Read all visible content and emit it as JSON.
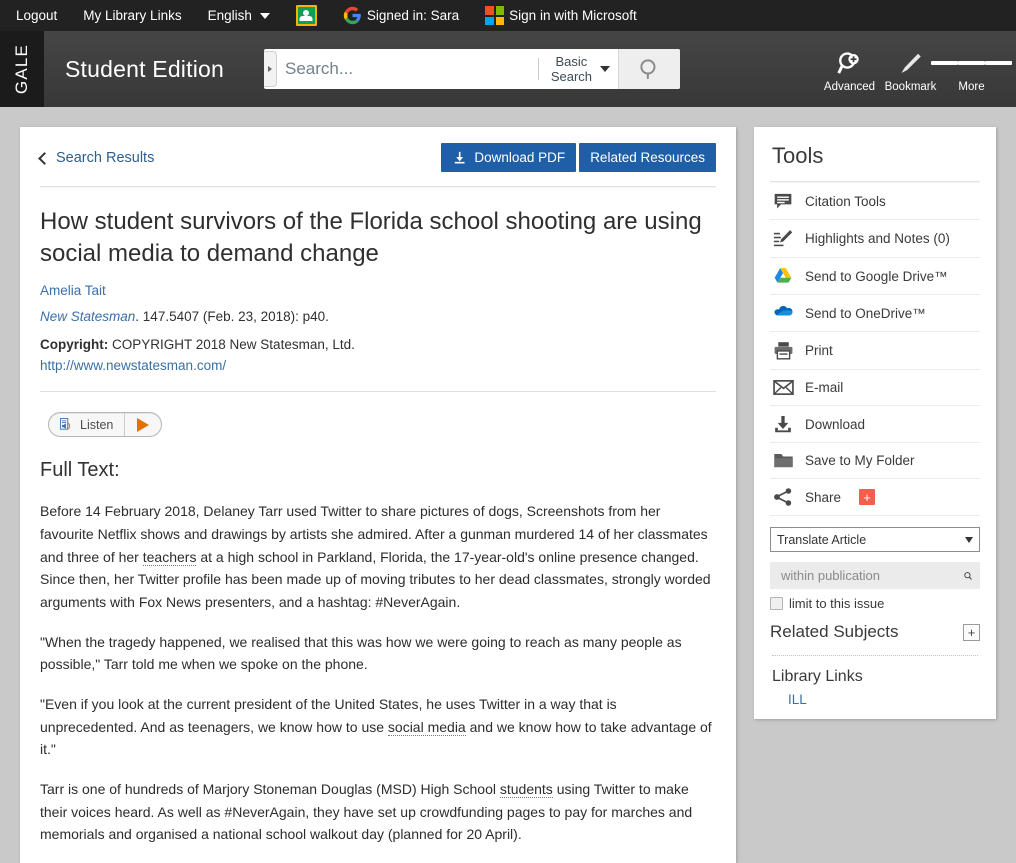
{
  "topbar": {
    "logout": "Logout",
    "my_library_links": "My Library Links",
    "language": "English",
    "google_classroom_icon": "google-classroom-icon",
    "google_signed_in": "Signed in: Sara",
    "microsoft_signin": "Sign in with Microsoft"
  },
  "masthead": {
    "brand": "GALE",
    "product": "Student Edition",
    "search_placeholder": "Search...",
    "search_value": "",
    "search_mode_line1": "Basic",
    "search_mode_line2": "Search",
    "search_button_icon": "search-icon",
    "nav": [
      {
        "label": "Advanced",
        "icon": "advanced-search-icon"
      },
      {
        "label": "Bookmark",
        "icon": "bookmark-icon"
      },
      {
        "label": "More",
        "icon": "hamburger-icon"
      }
    ]
  },
  "article": {
    "back_link": "Search Results",
    "download_pdf": "Download PDF",
    "related_resources": "Related Resources",
    "title": "How student survivors of the Florida school shooting are using social media to demand change",
    "author": "Amelia Tait",
    "journal": "New Statesman",
    "citation": ". 147.5407 (Feb. 23, 2018): p40.",
    "copyright_label": "Copyright:",
    "copyright_text": " COPYRIGHT 2018 New Statesman, Ltd.",
    "copyright_url": "http://www.newstatesman.com/",
    "listen_label": "Listen",
    "fulltext_heading": "Full Text:",
    "paragraphs": [
      {
        "parts": [
          {
            "t": "Before 14 February 2018, Delaney Tarr used Twitter to share pictures of dogs, Screenshots from her favourite Netflix shows and drawings by artists she admired. After a gunman murdered 14 of her classmates and three of her ",
            "link": false
          },
          {
            "t": "teachers",
            "link": true
          },
          {
            "t": " at a high school in Parkland, Florida, the 17-year-old's online presence changed. Since then, her Twitter profile has been made up of moving tributes to her dead classmates, strongly worded arguments with Fox News presenters, and a hashtag: #NeverAgain.",
            "link": false
          }
        ]
      },
      {
        "parts": [
          {
            "t": "\"When the tragedy happened, we realised that this was how we were going to reach as many people as possible,\" Tarr told me when we spoke on the phone.",
            "link": false
          }
        ]
      },
      {
        "parts": [
          {
            "t": "\"Even if you look at the current president of the United States, he uses Twitter in a way that is unprecedented. And as teenagers, we know how to use ",
            "link": false
          },
          {
            "t": "social media",
            "link": true
          },
          {
            "t": " and we know how to take advantage of it.\"",
            "link": false
          }
        ]
      },
      {
        "parts": [
          {
            "t": "Tarr is one of hundreds of Marjory Stoneman Douglas (MSD) High School ",
            "link": false
          },
          {
            "t": "students",
            "link": true
          },
          {
            "t": " using Twitter to make their voices heard. As well as #NeverAgain, they have set up crowdfunding pages to pay for marches and memorials and organised a national school walkout day (planned for 20 April).",
            "link": false
          }
        ]
      }
    ]
  },
  "tools": {
    "heading": "Tools",
    "items": [
      {
        "label": "Citation Tools",
        "icon": "citation-icon",
        "badge": null
      },
      {
        "label": "Highlights and Notes (0)",
        "icon": "highlights-notes-icon",
        "badge": null
      },
      {
        "label": "Send to Google Drive™",
        "icon": "google-drive-icon",
        "badge": null
      },
      {
        "label": "Send to OneDrive™",
        "icon": "onedrive-icon",
        "badge": null
      },
      {
        "label": "Print",
        "icon": "printer-icon",
        "badge": null
      },
      {
        "label": "E-mail",
        "icon": "envelope-icon",
        "badge": null
      },
      {
        "label": "Download",
        "icon": "download-icon",
        "badge": null
      },
      {
        "label": "Save to My Folder",
        "icon": "folder-icon",
        "badge": null
      },
      {
        "label": "Share",
        "icon": "share-icon",
        "badge": "+"
      }
    ],
    "translate_selected": "Translate Article",
    "publication_search_placeholder": "within publication",
    "publication_search_value": "",
    "limit_to_issue": "limit to this issue",
    "related_subjects": "Related Subjects",
    "related_subjects_expand": "+",
    "library_links_heading": "Library Links",
    "library_link": "ILL"
  },
  "colors": {
    "accent_blue": "#1f5fa8",
    "link_blue": "#3b6fa5",
    "topbar_bg": "#222222",
    "masthead_bg": "#3d3d3d",
    "page_bg": "#c9c9c9",
    "share_badge": "#f2604b",
    "listen_play": "#e2700b"
  }
}
